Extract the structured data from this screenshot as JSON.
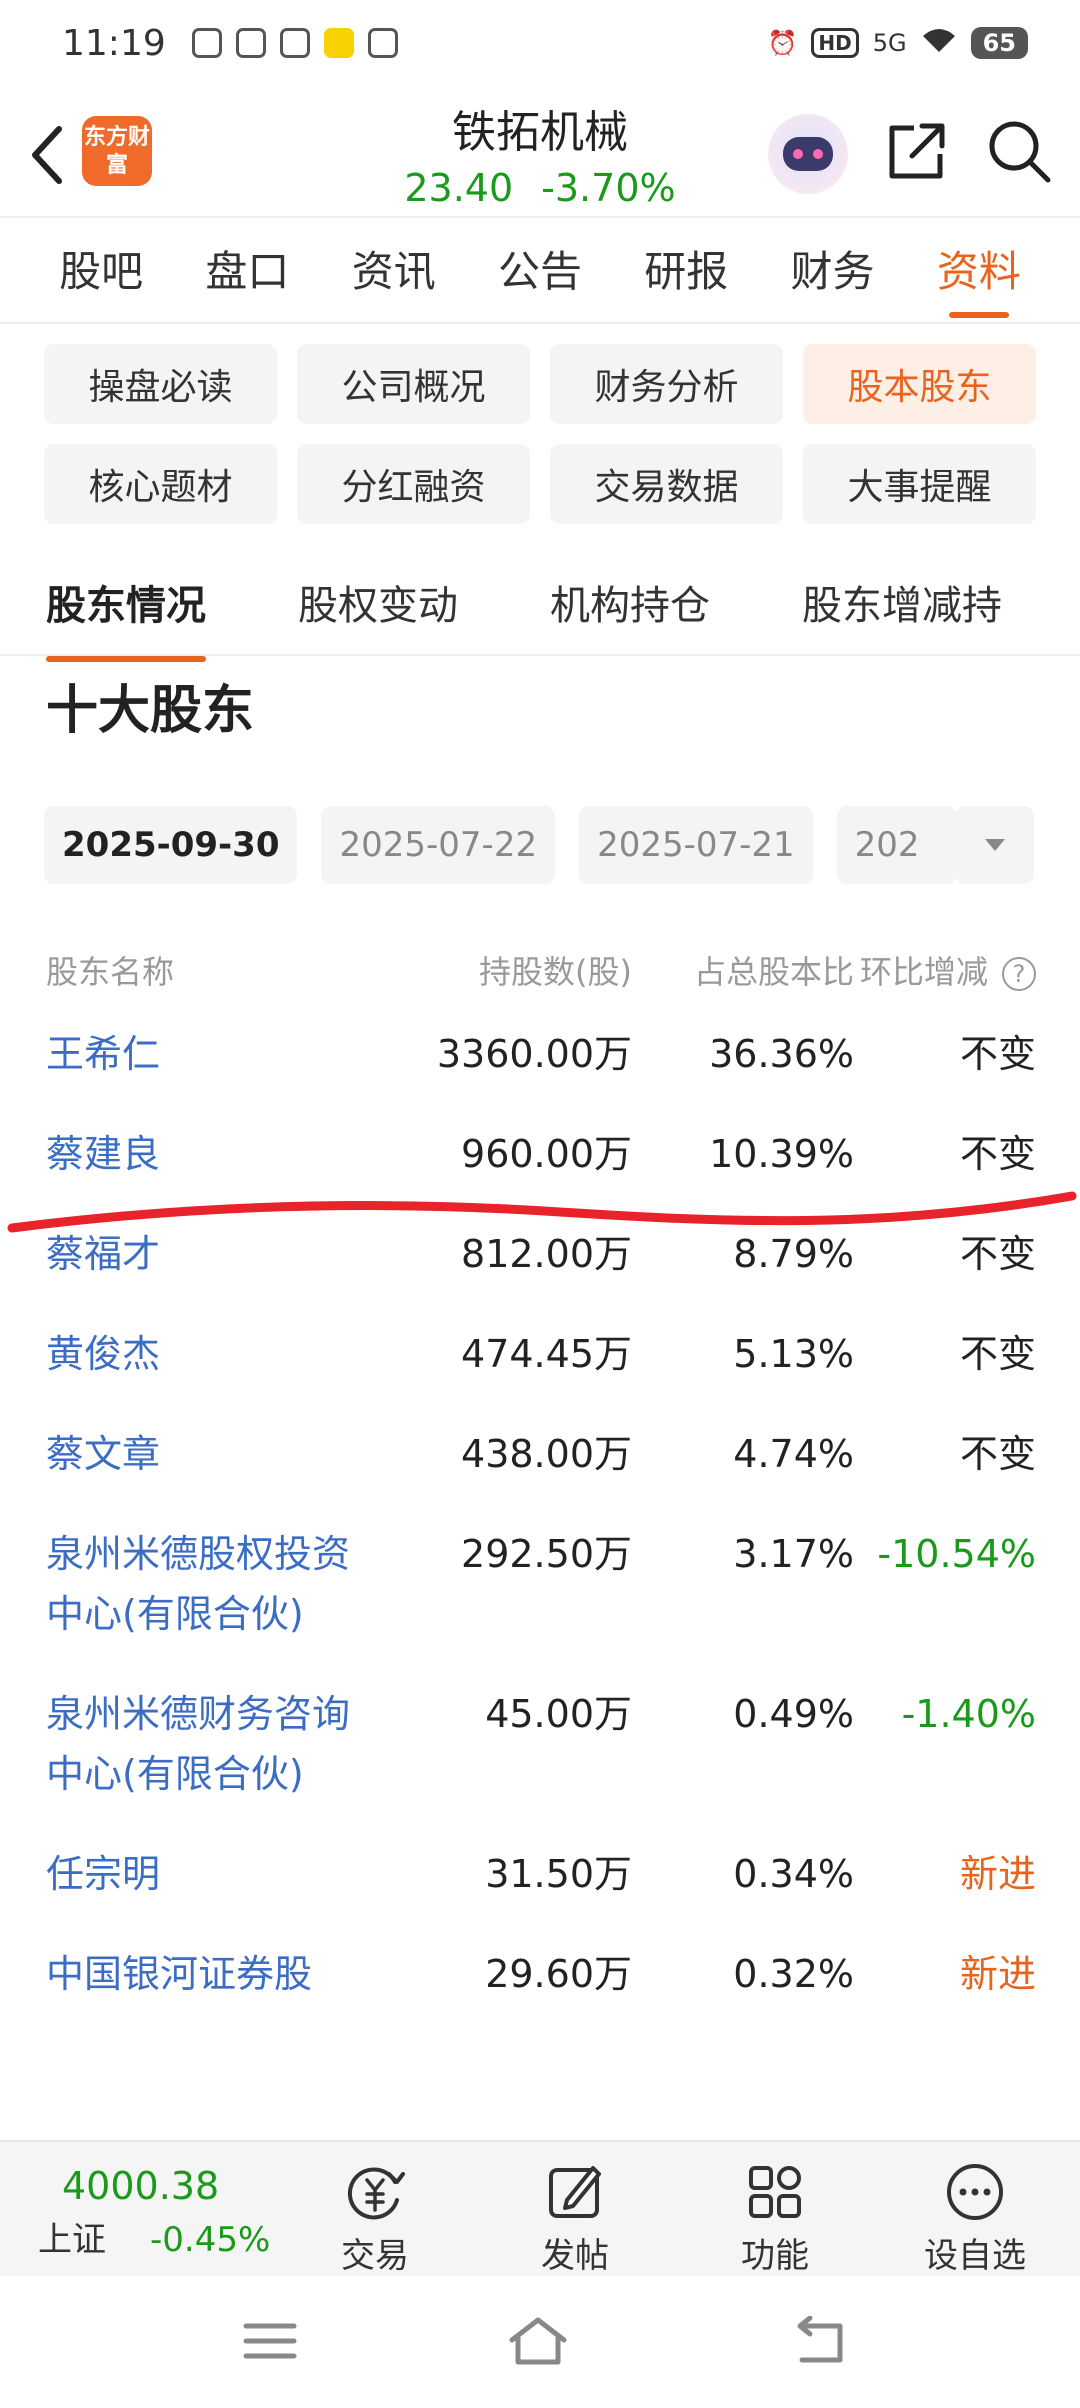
{
  "status_bar": {
    "time": "11:19",
    "network": "5G",
    "hd": "HD",
    "battery": "65"
  },
  "header": {
    "logo_text": "东方财富",
    "stock_name": "铁拓机械",
    "price": "23.40",
    "change_pct": "-3.70%"
  },
  "main_tabs": [
    {
      "label": "股吧"
    },
    {
      "label": "盘口"
    },
    {
      "label": "资讯"
    },
    {
      "label": "公告"
    },
    {
      "label": "研报"
    },
    {
      "label": "财务"
    },
    {
      "label": "资料",
      "active": true
    }
  ],
  "sub_buttons": [
    {
      "label": "操盘必读"
    },
    {
      "label": "公司概况"
    },
    {
      "label": "财务分析"
    },
    {
      "label": "股本股东",
      "active": true
    },
    {
      "label": "核心题材"
    },
    {
      "label": "分红融资"
    },
    {
      "label": "交易数据"
    },
    {
      "label": "大事提醒"
    }
  ],
  "section_tabs": [
    {
      "label": "股东情况",
      "active": true
    },
    {
      "label": "股权变动"
    },
    {
      "label": "机构持仓"
    },
    {
      "label": "股东增减持"
    }
  ],
  "section_title": "十大股东",
  "dates": [
    {
      "label": "2025-09-30",
      "active": true
    },
    {
      "label": "2025-07-22"
    },
    {
      "label": "2025-07-21"
    },
    {
      "label": "202"
    }
  ],
  "table": {
    "headers": {
      "name": "股东名称",
      "shares": "持股数(股)",
      "ratio": "占总股本比",
      "change": "环比增减"
    },
    "rows": [
      {
        "name": "王希仁",
        "shares": "3360.00万",
        "ratio": "36.36%",
        "change": "不变",
        "type": "same"
      },
      {
        "name": "蔡建良",
        "shares": "960.00万",
        "ratio": "10.39%",
        "change": "不变",
        "type": "same"
      },
      {
        "name": "蔡福才",
        "shares": "812.00万",
        "ratio": "8.79%",
        "change": "不变",
        "type": "same"
      },
      {
        "name": "黄俊杰",
        "shares": "474.45万",
        "ratio": "5.13%",
        "change": "不变",
        "type": "same"
      },
      {
        "name": "蔡文章",
        "shares": "438.00万",
        "ratio": "4.74%",
        "change": "不变",
        "type": "same"
      },
      {
        "name": "泉州米德股权投资中心(有限合伙)",
        "shares": "292.50万",
        "ratio": "3.17%",
        "change": "-10.54%",
        "type": "down"
      },
      {
        "name": "泉州米德财务咨询中心(有限合伙)",
        "shares": "45.00万",
        "ratio": "0.49%",
        "change": "-1.40%",
        "type": "down"
      },
      {
        "name": "任宗明",
        "shares": "31.50万",
        "ratio": "0.34%",
        "change": "新进",
        "type": "new"
      },
      {
        "name": "中国银河证券股",
        "shares": "29.60万",
        "ratio": "0.32%",
        "change": "新进",
        "type": "new"
      }
    ]
  },
  "bottom_bar": {
    "index_value": "4000.38",
    "index_label": "上证",
    "index_change": "-0.45%",
    "trade": "交易",
    "post": "发帖",
    "functions": "功能",
    "watchlist": "设自选"
  },
  "colors": {
    "accent": "#e8641e",
    "link_blue": "#3b6dc4",
    "down_green": "#1a9a1a",
    "annotation_red": "#e8232b"
  }
}
